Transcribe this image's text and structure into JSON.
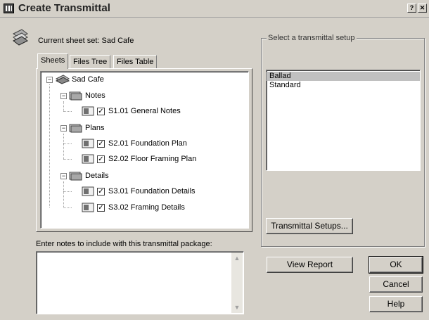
{
  "window": {
    "title": "Create Transmittal",
    "help_btn": "?",
    "close_btn": "✕"
  },
  "header": {
    "current_sheet_set": "Current sheet set: Sad Cafe"
  },
  "tabs": [
    {
      "label": "Sheets",
      "active": true
    },
    {
      "label": "Files Tree",
      "active": false
    },
    {
      "label": "Files Table",
      "active": false
    }
  ],
  "tree": {
    "root": {
      "label": "Sad Cafe",
      "expander": "⊟"
    },
    "groups": [
      {
        "label": "Notes",
        "expander": "⊟",
        "sheets": [
          {
            "label": "S1.01 General Notes",
            "checked": true
          }
        ]
      },
      {
        "label": "Plans",
        "expander": "⊟",
        "sheets": [
          {
            "label": "S2.01 Foundation Plan",
            "checked": true
          },
          {
            "label": "S2.02 Floor Framing Plan",
            "checked": true
          }
        ]
      },
      {
        "label": "Details",
        "expander": "⊟",
        "sheets": [
          {
            "label": "S3.01 Foundation Details",
            "checked": true
          },
          {
            "label": "S3.02 Framing Details",
            "checked": true
          }
        ]
      }
    ],
    "check_glyph": "✓",
    "minus_glyph": "−"
  },
  "setup": {
    "group_label": "Select a transmittal setup",
    "items": [
      {
        "label": "Ballad",
        "selected": true
      },
      {
        "label": "Standard",
        "selected": false
      }
    ],
    "setups_button": "Transmittal Setups..."
  },
  "notes": {
    "label": "Enter notes to include with this transmittal package:",
    "value": "",
    "scroll_up": "▲",
    "scroll_down": "▼"
  },
  "buttons": {
    "view_report": "View Report",
    "ok": "OK",
    "cancel": "Cancel",
    "help": "Help"
  },
  "colors": {
    "face": "#d4d0c8",
    "selection": "#c0c0c0"
  }
}
